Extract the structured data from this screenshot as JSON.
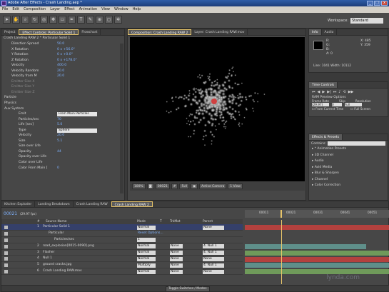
{
  "window": {
    "title": "Adobe After Effects - Crash Landing.aep *",
    "buttons": [
      "_",
      "□",
      "x"
    ]
  },
  "menu": [
    "File",
    "Edit",
    "Composition",
    "Layer",
    "Effect",
    "Animation",
    "View",
    "Window",
    "Help"
  ],
  "toolbar": {
    "workspace_label": "Workspace:",
    "workspace_value": "Standard"
  },
  "left_tabs": [
    "Project",
    "Effect Controls: Particular Solid 1",
    "Flowchart"
  ],
  "effect_controls": {
    "header": "Crash Landing RAW 2 * Particular Solid 1",
    "rows": [
      {
        "label": "Direction Spread",
        "value": "50.0",
        "ind": 1
      },
      {
        "label": "X Rotation",
        "value": "0 x +56.0°",
        "ind": 1
      },
      {
        "label": "Y Rotation",
        "value": "0 x +0.0°",
        "ind": 1
      },
      {
        "label": "Z Rotation",
        "value": "0 x +178.0°",
        "ind": 1
      },
      {
        "label": "Velocity",
        "value": "400.0",
        "ind": 1
      },
      {
        "label": "Velocity Random",
        "value": "20.0",
        "ind": 1
      },
      {
        "label": "Velocity from M",
        "value": "20.0",
        "ind": 1
      },
      {
        "label": "Emitter Size X",
        "value": "",
        "ind": 1,
        "dim": true
      },
      {
        "label": "Emitter Size Y",
        "value": "",
        "ind": 1,
        "dim": true
      },
      {
        "label": "Emitter Size Z",
        "value": "",
        "ind": 1,
        "dim": true
      },
      {
        "label": "Particle",
        "value": "",
        "ind": 0
      },
      {
        "label": "Physics",
        "value": "",
        "ind": 0
      },
      {
        "label": "Aux System",
        "value": "",
        "ind": 0
      },
      {
        "label": "Emit",
        "value": "From Main Particles",
        "ind": 2,
        "dropdown": true
      },
      {
        "label": "Particles/sec",
        "value": "70",
        "ind": 2
      },
      {
        "label": "Life [sec]",
        "value": "5.0",
        "ind": 2
      },
      {
        "label": "Type",
        "value": "Sphere",
        "ind": 2,
        "dropdown": true
      },
      {
        "label": "Velocity",
        "value": "20.0",
        "ind": 2
      },
      {
        "label": "Size",
        "value": "5.1",
        "ind": 2
      },
      {
        "label": "Size over Life",
        "value": "",
        "ind": 2
      },
      {
        "label": "Opacity",
        "value": "44",
        "ind": 2
      },
      {
        "label": "Opacity over Life",
        "value": "",
        "ind": 2
      },
      {
        "label": "Color over Life",
        "value": "",
        "ind": 2
      },
      {
        "label": "Color From Main [",
        "value": "0",
        "ind": 2
      }
    ]
  },
  "comp": {
    "tabs": [
      "Composition: Crash Landing RAW 2",
      "Layer: Crash Landing RAW.mov"
    ],
    "viewer_bar": [
      "100%",
      "00021",
      "Full",
      "Active Camera",
      "1 View"
    ]
  },
  "right": {
    "info_tabs": [
      "Info",
      "Audio"
    ],
    "info_lines": [
      "R:",
      "G:",
      "B:",
      "A: 0"
    ],
    "coords": [
      "X: 485",
      "Y: 359"
    ],
    "footer": "Line: 1041 Width: 10112",
    "time_controls_tab": "Time Controls",
    "ram_preview": "RAM Preview Options",
    "tc_labels": [
      "Frame Rate",
      "Skip",
      "Resolution"
    ],
    "tc_values": [
      "(29.97)",
      "0",
      "Full"
    ],
    "tc_checks": [
      "From Current Time",
      "Full Screen"
    ],
    "effects_tab": "Effects & Presets",
    "contains_label": "Contains:",
    "effects_list": [
      "* Animation Presets",
      "3D Channel",
      "Audio",
      "Avid Media",
      "Blur & Sharpen",
      "Channel",
      "Color Correction"
    ]
  },
  "timeline": {
    "tabs": [
      "Kitchen Exploder",
      "Landing Breakdown",
      "Crash Landing RAW",
      "Crash Landing RAW 2"
    ],
    "timecode": "00021",
    "fps": "(29.97 fps)",
    "headers": [
      "#",
      "Source Name",
      "Mode",
      "T",
      "TrkMat",
      "Parent"
    ],
    "layers": [
      {
        "num": "1",
        "name": "Particular Solid 1",
        "mode": "Normal",
        "trk": "",
        "parent": "None",
        "sel": true
      },
      {
        "num": "",
        "name": "Particular",
        "mode": "Reset   Options...",
        "trk": "",
        "parent": "",
        "fx": true
      },
      {
        "num": "",
        "name": "Particles/sec",
        "mode": "1",
        "trk": "",
        "parent": "",
        "sub": true
      },
      {
        "num": "2",
        "name": "road_explosion[0015-0090].png",
        "mode": "Normal",
        "trk": "None",
        "parent": "4. Null 1"
      },
      {
        "num": "3",
        "name": "Flasher",
        "mode": "Normal",
        "trk": "None",
        "parent": "4. Null 1"
      },
      {
        "num": "4",
        "name": "Null 1",
        "mode": "Normal",
        "trk": "None",
        "parent": "None"
      },
      {
        "num": "5",
        "name": "ground cracks.jpg",
        "mode": "Multiply",
        "trk": "None",
        "parent": "4. Null 1"
      },
      {
        "num": "6",
        "name": "Crash Landing RAW.mov",
        "mode": "Normal",
        "trk": "None",
        "parent": "None"
      }
    ],
    "ruler_labels": [
      "00011",
      "00021",
      "00031",
      "00041",
      "00051"
    ],
    "toggle": "Toggle Switches / Modes",
    "watermark": "lynda.com"
  },
  "colors": {
    "accent": "#e8c56a",
    "sel_layer": "#35406a",
    "bar_red": "#b3413e",
    "bar_teal": "#5f8f8a",
    "bar_green": "#6f9a5a"
  }
}
